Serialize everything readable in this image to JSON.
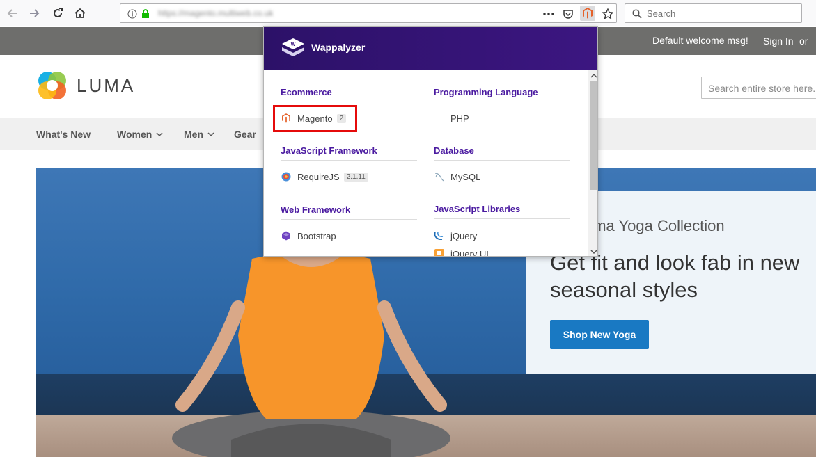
{
  "browser": {
    "url": "https://magento.multiweb.co.uk",
    "search_placeholder": "Search"
  },
  "header": {
    "welcome": "Default welcome msg!",
    "sign_in": "Sign In",
    "or": "or"
  },
  "logo": {
    "text": "LUMA"
  },
  "store_search": {
    "placeholder": "Search entire store here..."
  },
  "nav": {
    "items": [
      {
        "label": "What's New"
      },
      {
        "label": "Women"
      },
      {
        "label": "Men"
      },
      {
        "label": "Gear"
      }
    ]
  },
  "hero": {
    "subtitle": "uma Yoga Collection",
    "title": "Get fit and look fab in new seasonal styles",
    "button": "Shop New Yoga"
  },
  "wappalyzer": {
    "brand": "Wappalyzer",
    "categories": [
      {
        "name": "Ecommerce",
        "apps": [
          {
            "name": "Magento",
            "version": "2"
          }
        ]
      },
      {
        "name": "Programming Language",
        "apps": [
          {
            "name": "PHP"
          }
        ]
      },
      {
        "name": "JavaScript Framework",
        "apps": [
          {
            "name": "RequireJS",
            "version": "2.1.11"
          }
        ]
      },
      {
        "name": "Database",
        "apps": [
          {
            "name": "MySQL"
          }
        ]
      },
      {
        "name": "Web Framework",
        "apps": [
          {
            "name": "Bootstrap"
          }
        ]
      },
      {
        "name": "JavaScript Libraries",
        "apps": [
          {
            "name": "jQuery"
          },
          {
            "name": "jQuery UI"
          }
        ]
      }
    ]
  },
  "colors": {
    "header_bg": "#6e6e6c",
    "popup_header": "#2c1168",
    "category_text": "#4a1aa0",
    "highlight": "#e50b0b",
    "shop_button": "#1979c3"
  }
}
